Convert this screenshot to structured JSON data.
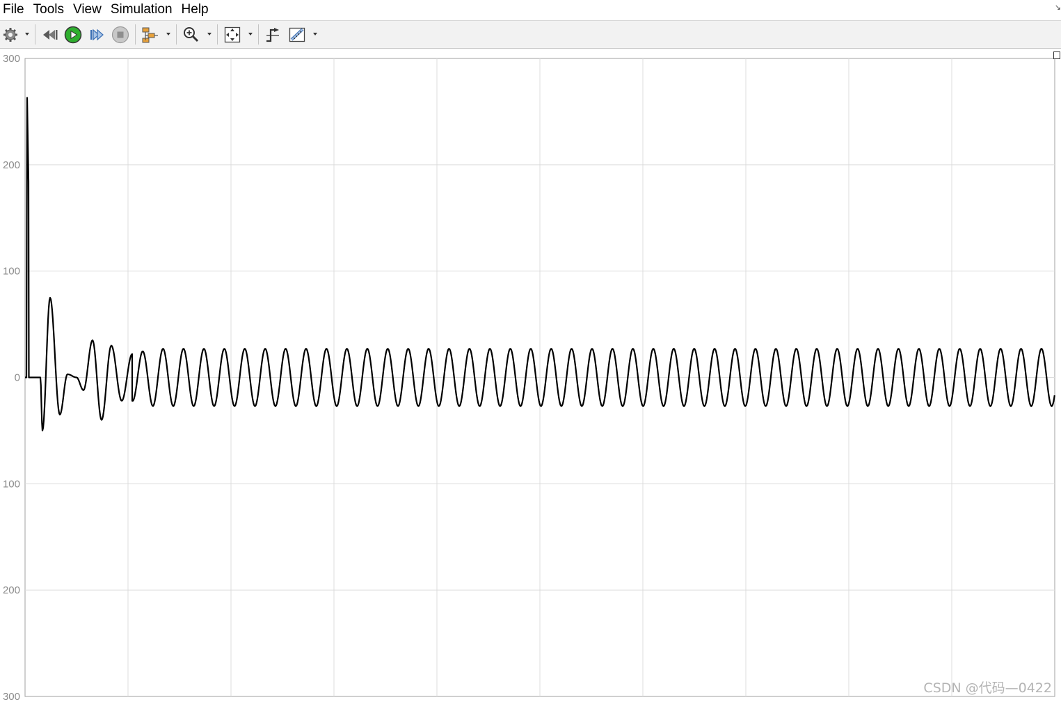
{
  "menu": {
    "items": [
      "File",
      "Tools",
      "View",
      "Simulation",
      "Help"
    ],
    "corner": "↘"
  },
  "toolbar": {
    "buttons": [
      {
        "name": "settings-icon",
        "dropdown": true
      },
      {
        "name": "step-back-icon",
        "dropdown": false
      },
      {
        "name": "run-icon",
        "dropdown": false
      },
      {
        "name": "step-forward-icon",
        "dropdown": false
      },
      {
        "name": "stop-icon",
        "dropdown": false
      },
      {
        "name": "signal-highlight-icon",
        "dropdown": true
      },
      {
        "name": "zoom-in-icon",
        "dropdown": true
      },
      {
        "name": "fit-to-view-icon",
        "dropdown": true
      },
      {
        "name": "triggers-icon",
        "dropdown": false
      },
      {
        "name": "measurements-icon",
        "dropdown": true
      }
    ]
  },
  "colors": {
    "line": "#000000",
    "grid": "#dcdcdc",
    "axis_text": "#8a8a8a",
    "toolbar_bg": "#f2f2f2",
    "run_green": "#2fae2f"
  },
  "chart_data": {
    "type": "line",
    "ylim": [
      -300,
      300
    ],
    "yticks": [
      "300",
      "200",
      "100",
      "0",
      "100",
      "200",
      "300"
    ],
    "x_gridlines": 10,
    "grid": true,
    "series": [
      {
        "values_description": "initial spike near 263 at start, transient oscillations (peak ~75, trough ~-50), then steady sinusoid amplitude ~27",
        "spike_peak": 263,
        "transient": [
          0,
          0,
          -50,
          75,
          -35,
          3,
          0,
          -12,
          35,
          -40,
          30,
          -22,
          22
        ],
        "steady_amplitude": 27,
        "steady_cycles": 47
      }
    ]
  },
  "watermark": "CSDN @代码—0422"
}
